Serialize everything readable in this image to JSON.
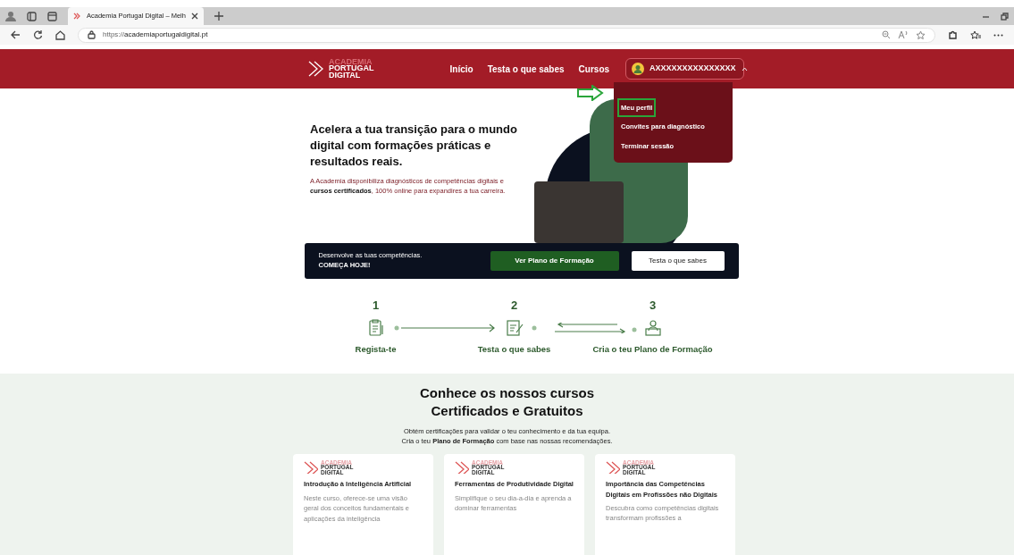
{
  "browser": {
    "tabs": [
      {
        "title": "Academia Portugal Digital – Melh",
        "selected": true
      }
    ],
    "url_scheme": "https://",
    "url_host": "academiaportugaldigital.pt"
  },
  "header": {
    "logo_lines": [
      "ACADEMIA",
      "PORTUGAL",
      "DIGITAL"
    ],
    "nav": [
      {
        "label": "Início"
      },
      {
        "label": "Testa o que sabes"
      },
      {
        "label": "Cursos"
      }
    ],
    "user": {
      "name": "AXXXXXXXXXXXXXXX",
      "expanded": true
    },
    "user_menu": [
      {
        "label": "Meu perfil",
        "highlighted": true
      },
      {
        "label": "Convites para diagnóstico",
        "highlighted": false
      },
      {
        "label": "Terminar sessão",
        "highlighted": false
      }
    ]
  },
  "hero": {
    "title": "Acelera a tua transição para o mundo digital com formações práticas e resultados reais.",
    "text": "A Academia disponibiliza diagnósticos de competências digitais e **cursos certificados**, 100% online para expandires a tua carreira."
  },
  "cta": {
    "line1": "Desenvolve as tuas competências.",
    "line2": "COMEÇA HOJE!",
    "buttons": [
      {
        "label": "Ver Plano de Formação",
        "kind": "primary"
      },
      {
        "label": "Testa o que sabes",
        "kind": "secondary"
      }
    ]
  },
  "steps": [
    {
      "number": "1",
      "label": "Regista-te"
    },
    {
      "number": "2",
      "label": "Testa o que sabes"
    },
    {
      "number": "3",
      "label": "Cria o teu Plano de Formação"
    }
  ],
  "courses": {
    "title_lines": [
      "Conhece os nossos cursos",
      "Certificados e Gratuitos"
    ],
    "lines": [
      "Obtém certificações para validar o teu conhecimento e da tua equipa.",
      "Cria o teu **Plano de Formação** com base nas nossas recomendações."
    ],
    "cards": [
      {
        "logo_lines": [
          "ACADEMIA",
          "PORTUGAL",
          "DIGITAL"
        ],
        "title": "Introdução à Inteligência Artificial",
        "text": "Neste curso, oferece-se uma visão geral dos conceitos fundamentais e aplicações da inteligência"
      },
      {
        "logo_lines": [
          "ACADEMIA",
          "PORTUGAL",
          "DIGITAL"
        ],
        "title": "Ferramentas de Produtividade Digital",
        "text": "Simplifique o seu dia-a-dia e aprenda a dominar ferramentas"
      },
      {
        "logo_lines": [
          "ACADEMIA",
          "PORTUGAL",
          "DIGITAL"
        ],
        "title": "Importância das Competências Digitais em Profissões não Digitais",
        "text": "Descubra como competências digitais transformam profissões a"
      }
    ]
  }
}
